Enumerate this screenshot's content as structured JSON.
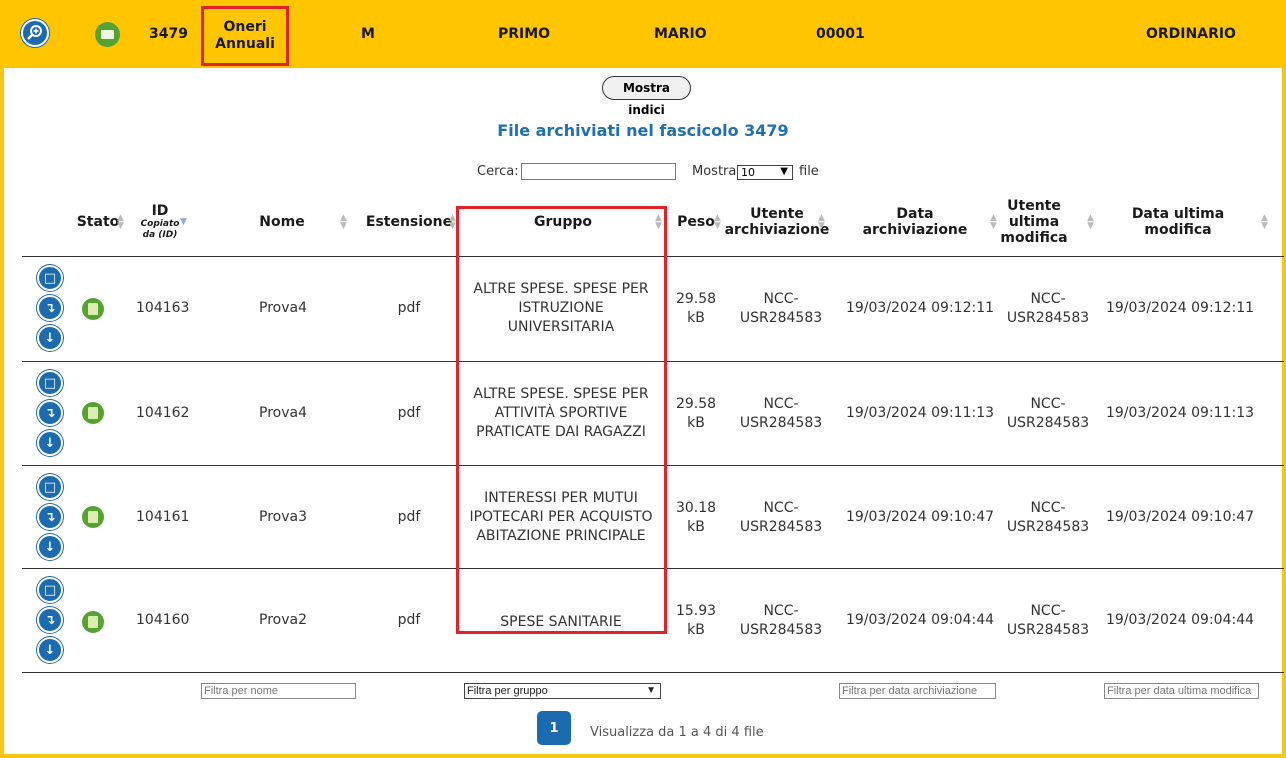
{
  "header": {
    "practice_id": "3479",
    "tab_label": "Oneri Annuali",
    "sex": "M",
    "surname": "PRIMO",
    "name": "MARIO",
    "code": "00001",
    "type": "ORDINARIO",
    "colors": {
      "bar": "#ffc600",
      "highlight": "#e1222a"
    }
  },
  "toolbar": {
    "show_index_label": "Mostra indici"
  },
  "main": {
    "title": "File archiviati nel fascicolo 3479",
    "search_label": "Cerca:",
    "search_value": "",
    "show_label": "Mostra",
    "page_size": "10",
    "file_label": "file"
  },
  "table": {
    "columns": {
      "stato": "Stato",
      "id": "ID",
      "id_sub": "Copiato da (ID)",
      "nome": "Nome",
      "estensione": "Estensione",
      "gruppo": "Gruppo",
      "peso": "Peso",
      "utente_arch": "Utente archiviazione",
      "data_arch": "Data archiviazione",
      "utente_mod": "Utente ultima modifica",
      "data_mod": "Data ultima modifica"
    },
    "rows": [
      {
        "id": "104163",
        "nome": "Prova4",
        "ext": "pdf",
        "gruppo": "ALTRE SPESE. SPESE PER ISTRUZIONE UNIVERSITARIA",
        "peso": "29.58 kB",
        "utente_arch": "NCC-USR284583",
        "data_arch": "19/03/2024 09:12:11",
        "utente_mod": "NCC-USR284583",
        "data_mod": "19/03/2024 09:12:11"
      },
      {
        "id": "104162",
        "nome": "Prova4",
        "ext": "pdf",
        "gruppo": "ALTRE SPESE. SPESE PER ATTIVITÀ SPORTIVE PRATICATE DAI RAGAZZI",
        "peso": "29.58 kB",
        "utente_arch": "NCC-USR284583",
        "data_arch": "19/03/2024 09:11:13",
        "utente_mod": "NCC-USR284583",
        "data_mod": "19/03/2024 09:11:13"
      },
      {
        "id": "104161",
        "nome": "Prova3",
        "ext": "pdf",
        "gruppo": "INTERESSI PER MUTUI IPOTECARI PER ACQUISTO ABITAZIONE PRINCIPALE",
        "peso": "30.18 kB",
        "utente_arch": "NCC-USR284583",
        "data_arch": "19/03/2024 09:10:47",
        "utente_mod": "NCC-USR284583",
        "data_mod": "19/03/2024 09:10:47"
      },
      {
        "id": "104160",
        "nome": "Prova2",
        "ext": "pdf",
        "gruppo": "SPESE SANITARIE",
        "peso": "15.93 kB",
        "utente_arch": "NCC-USR284583",
        "data_arch": "19/03/2024 09:04:44",
        "utente_mod": "NCC-USR284583",
        "data_mod": "19/03/2024 09:04:44"
      }
    ]
  },
  "filters": {
    "nome_placeholder": "Filtra per nome",
    "gruppo_value": "Filtra per gruppo",
    "data_arch_placeholder": "Filtra per data archiviazione",
    "data_mod_placeholder": "Filtra per data ultima modifica"
  },
  "pagination": {
    "current": "1",
    "info": "Visualizza da 1 a 4 di 4 file"
  }
}
